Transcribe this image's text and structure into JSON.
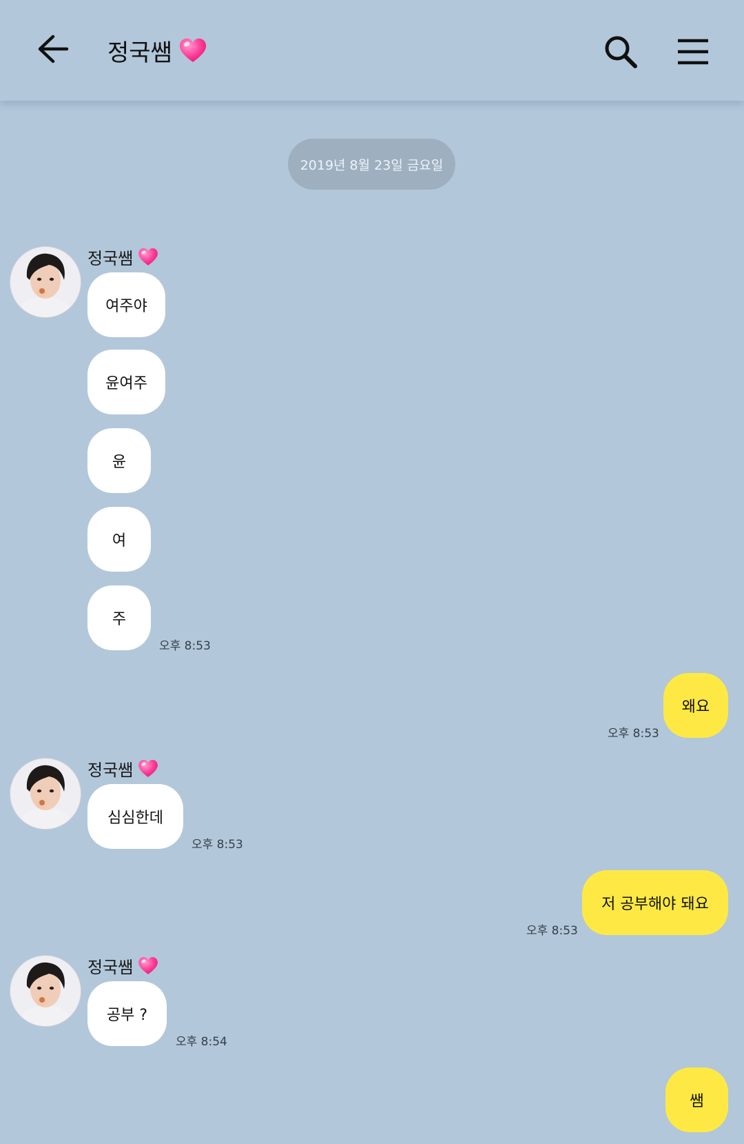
{
  "header": {
    "title": "정국쌤",
    "back_icon": "arrow-left-icon",
    "search_icon": "search-icon",
    "menu_icon": "hamburger-menu-icon",
    "heart_icon": "heart-icon"
  },
  "date_divider": "2019년 8월 23일 금요일",
  "colors": {
    "background": "#b2c7da",
    "incoming_bubble": "#ffffff",
    "outgoing_bubble": "#fee944",
    "date_pill": "#9eb0c0",
    "heart": "#ff3d96"
  },
  "messages": {
    "g1": {
      "sender": "정국쌤",
      "m1": "여주야",
      "m2": "윤여주",
      "m3": "윤",
      "m4": "여",
      "m5": "주",
      "time": "오후 8:53"
    },
    "o1": {
      "text": "왜요",
      "time": "오후 8:53"
    },
    "g2": {
      "sender": "정국쌤",
      "m1": "심심한데",
      "time": "오후 8:53"
    },
    "o2": {
      "text": "저 공부해야 돼요",
      "time": "오후 8:53"
    },
    "g3": {
      "sender": "정국쌤",
      "m1": "공부 ?",
      "time": "오후 8:54"
    },
    "o3": {
      "text": "쌤"
    }
  }
}
